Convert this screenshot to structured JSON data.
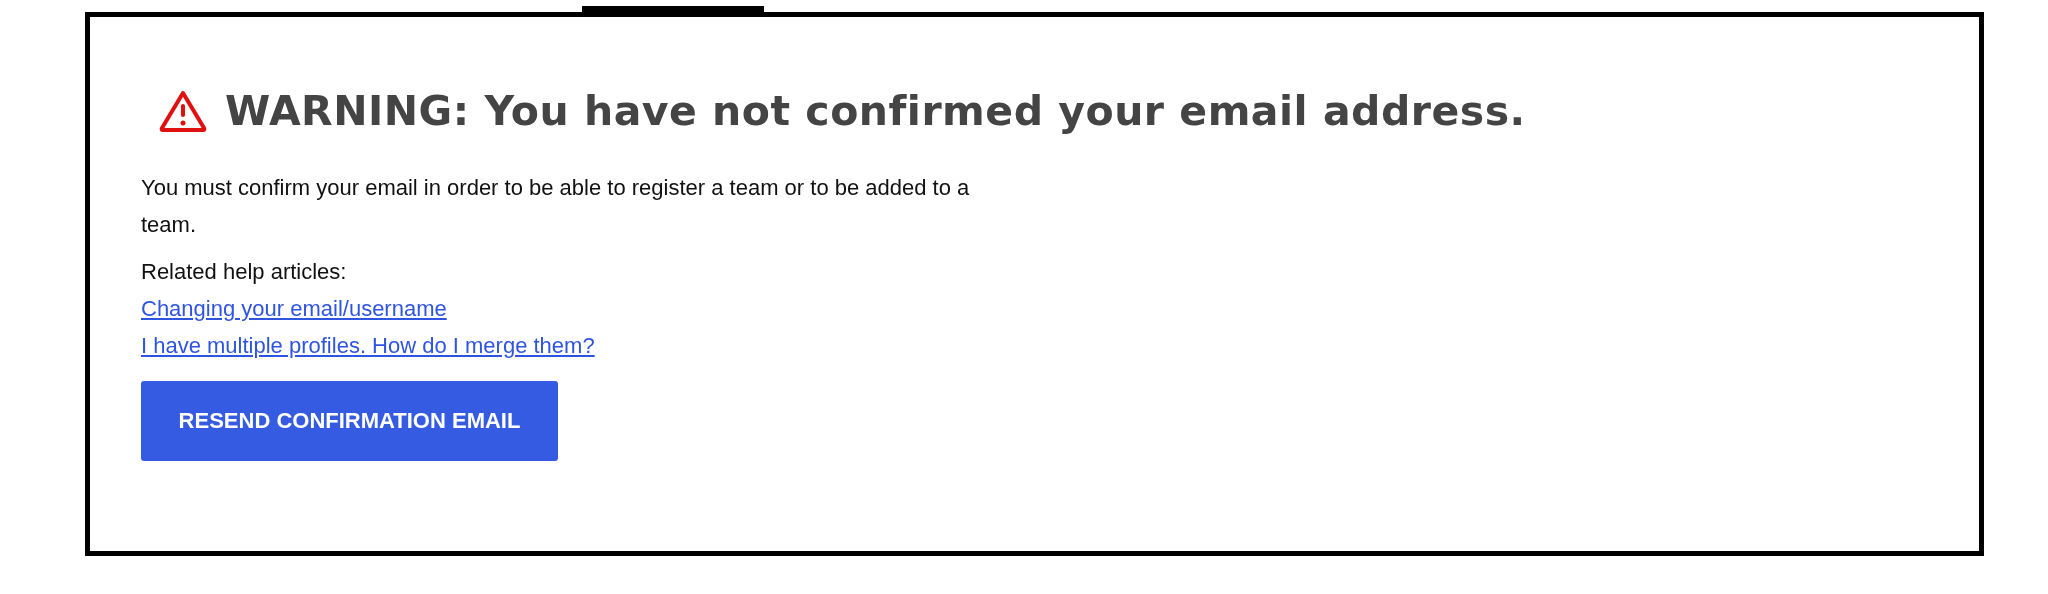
{
  "warning": {
    "title": "WARNING: You have not confirmed your email address.",
    "message": "You must confirm your email in order to be able to register a team or to be added to a team.",
    "help_heading": "Related help articles:",
    "help_links": [
      "Changing your email/username",
      "I have multiple profiles. How do I merge them?"
    ],
    "button": "RESEND CONFIRMATION EMAIL"
  }
}
